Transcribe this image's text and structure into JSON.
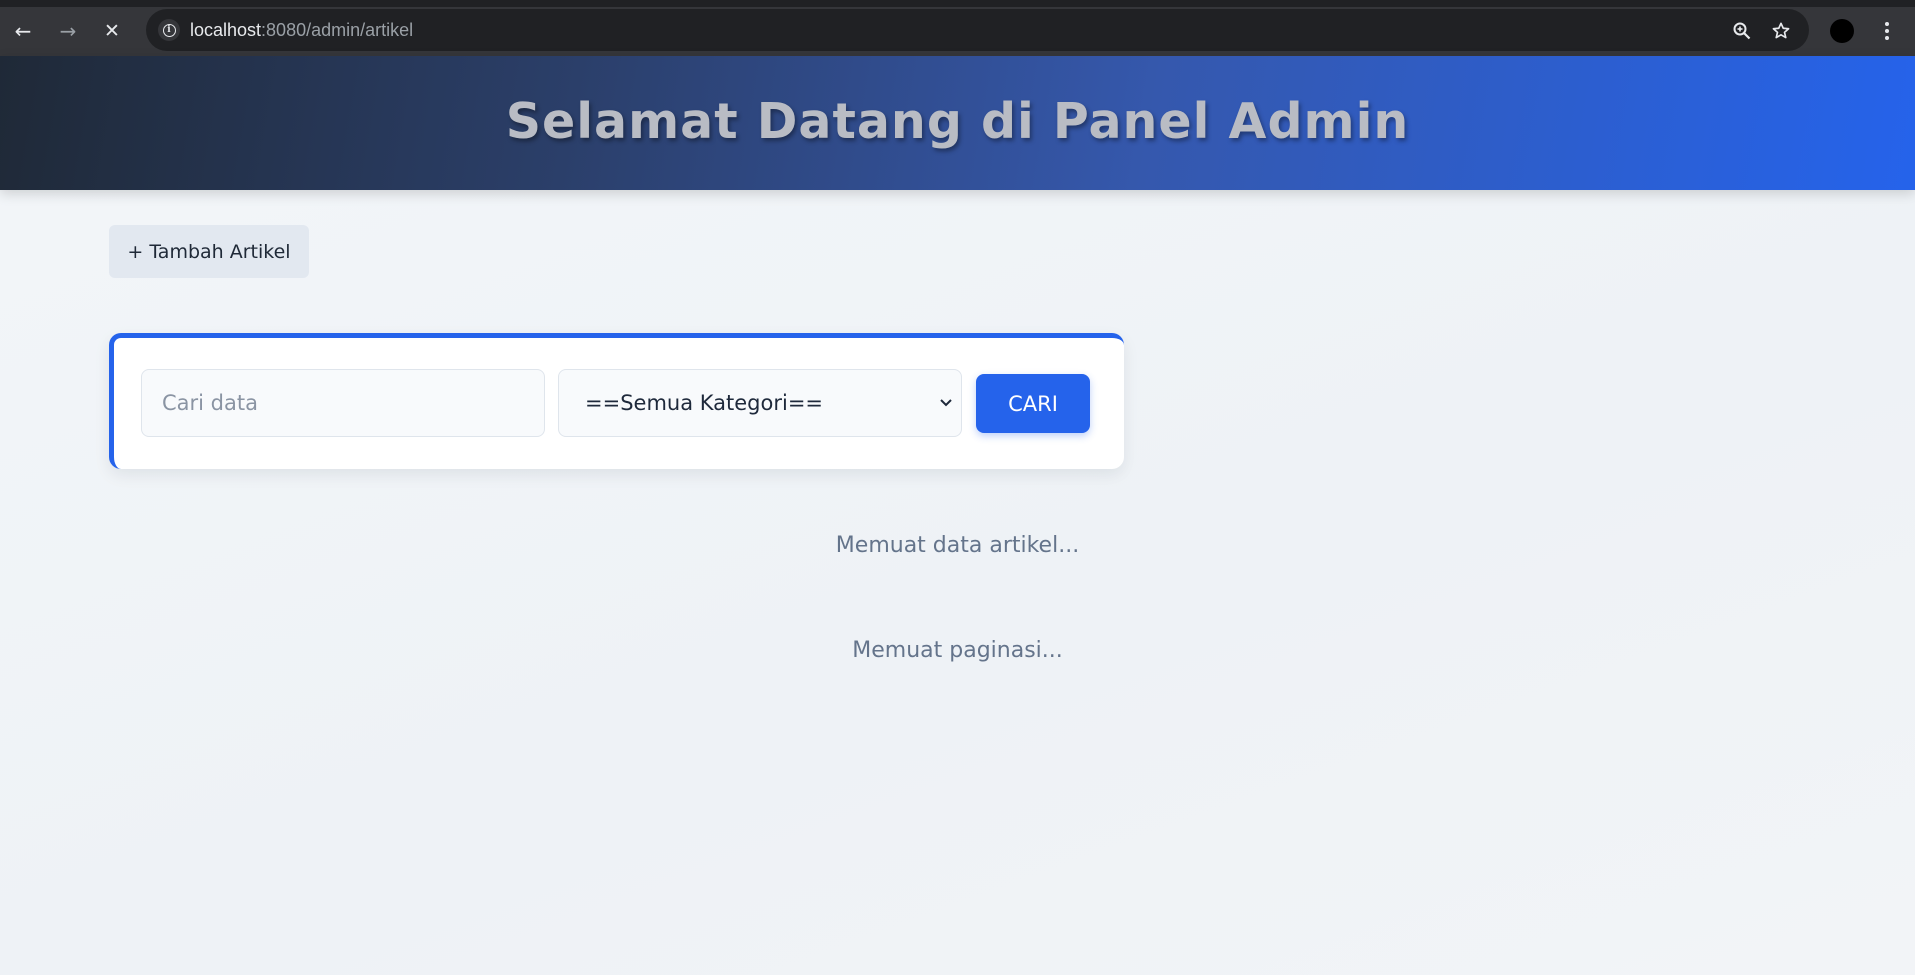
{
  "browser": {
    "url_host": "localhost",
    "url_path": ":8080/admin/artikel",
    "icons": {
      "back": "arrow-left-icon",
      "forward": "arrow-right-icon",
      "stop": "close-icon",
      "site_info": "info-icon",
      "zoom": "zoom-icon",
      "bookmark": "star-icon",
      "menu": "kebab-menu-icon"
    }
  },
  "header": {
    "title": "Selamat Datang di Panel Admin"
  },
  "toolbar": {
    "add_label": "+ Tambah Artikel"
  },
  "search": {
    "placeholder": "Cari data",
    "value": "",
    "category_selected": "==Semua Kategori==",
    "button_label": "CARI"
  },
  "status": {
    "articles_loading": "Memuat data artikel...",
    "pagination_loading": "Memuat paginasi..."
  },
  "colors": {
    "accent": "#2563eb",
    "header_start": "#1f2937",
    "header_end": "#2563eb"
  }
}
